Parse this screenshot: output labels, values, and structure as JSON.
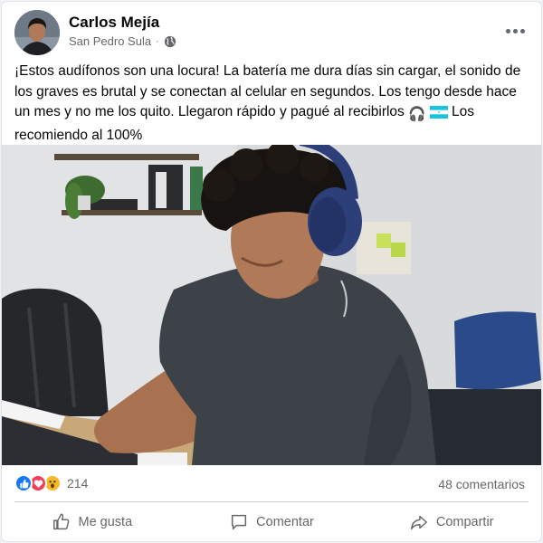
{
  "post": {
    "author": "Carlos Mejía",
    "location": "San Pedro Sula",
    "separator": "·",
    "privacy_icon": "globe-icon",
    "text_before_emoji": "¡Estos audífonos son una locura! La batería me dura días sin cargar, el sonido de los graves es brutal y se conectan al celular en segundos. Los tengo desde hace un mes y no me los quito. Llegaron rápido y pagué al recibirlos ",
    "emoji_headphones": "🎧",
    "emoji_flag": "honduras-flag-icon",
    "text_after_emoji": " Los recomiendo al 100%",
    "photo_description_icon": "photo-young-man-headphones"
  },
  "reactions": {
    "icons": [
      "like-icon",
      "love-icon",
      "wow-icon"
    ],
    "count": "214",
    "comments": "48 comentarios"
  },
  "actions": {
    "like": "Me gusta",
    "comment": "Comentar",
    "share": "Compartir"
  },
  "colors": {
    "like_blue": "#1877f2",
    "love_red": "#f33e58",
    "wow_yellow": "#f7b928",
    "secondary_text": "#65676b",
    "shirt": "#3d4249",
    "headphones": "#2d3f78"
  }
}
